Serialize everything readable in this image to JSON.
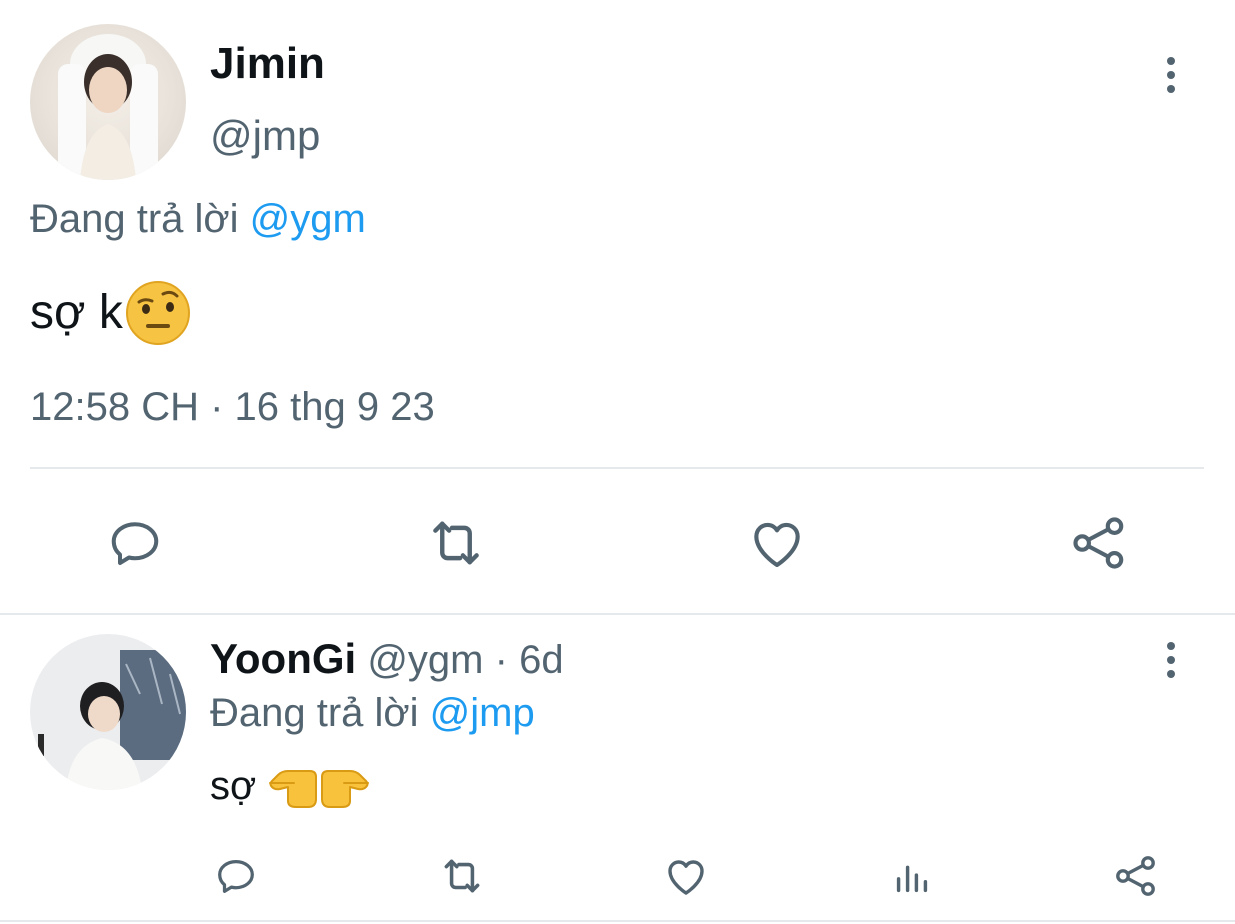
{
  "main_tweet": {
    "display_name": "Jimin",
    "handle": "@jmp",
    "replying_prefix": "Đang trả lời",
    "replying_to": "@ygm",
    "text": "sợ k",
    "timestamp": "12:58 CH · 16 thg 9 23",
    "actions": [
      "reply-icon",
      "retweet-icon",
      "like-icon",
      "share-icon"
    ]
  },
  "reply_tweet": {
    "display_name": "YoonGi",
    "handle": "@ygm",
    "separator": "·",
    "age": "6d",
    "replying_prefix": "Đang trả lời",
    "replying_to": "@jmp",
    "text": "sợ",
    "actions": [
      "reply-icon",
      "retweet-icon",
      "like-icon",
      "analytics-icon",
      "share-icon"
    ]
  },
  "colors": {
    "text": "#0f1419",
    "secondary": "#536471",
    "link": "#1d9bf0",
    "divider": "#e6e9ec"
  }
}
